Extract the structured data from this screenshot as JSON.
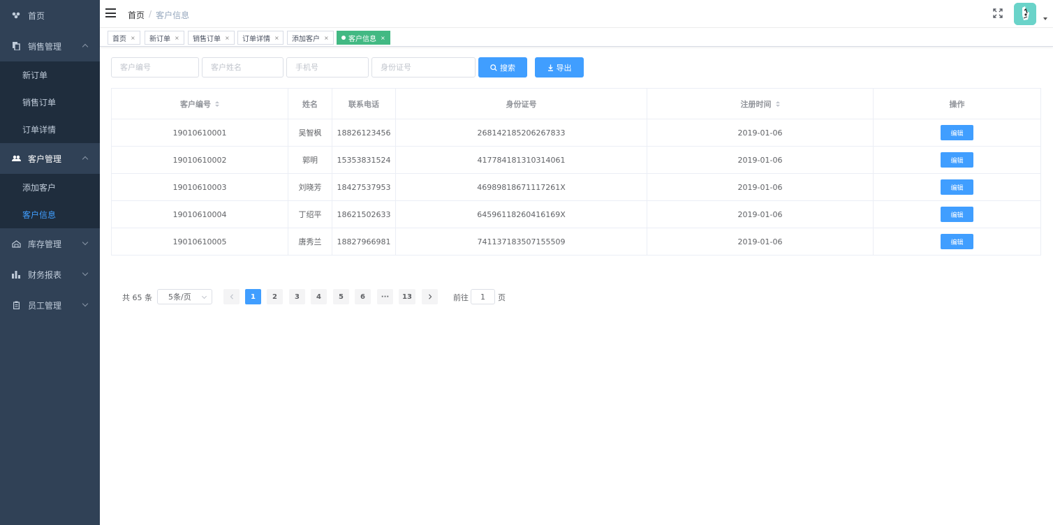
{
  "sidebar": {
    "home": {
      "label": "首页",
      "icon": "dashboard-icon"
    },
    "sales": {
      "label": "销售管理",
      "icon": "documents-icon",
      "items": [
        {
          "label": "新订单"
        },
        {
          "label": "销售订单"
        },
        {
          "label": "订单详情"
        }
      ]
    },
    "customers": {
      "label": "客户管理",
      "icon": "people-icon",
      "items": [
        {
          "label": "添加客户"
        },
        {
          "label": "客户信息"
        }
      ]
    },
    "inventory": {
      "label": "库存管理",
      "icon": "warehouse-icon"
    },
    "finance": {
      "label": "财务报表",
      "icon": "bar-chart-icon"
    },
    "staff": {
      "label": "员工管理",
      "icon": "clipboard-icon"
    }
  },
  "header": {
    "breadcrumb": [
      "首页",
      "客户信息"
    ],
    "breadcrumb_sep": "/"
  },
  "tags": [
    {
      "label": "首页"
    },
    {
      "label": "新订单"
    },
    {
      "label": "销售订单"
    },
    {
      "label": "订单详情"
    },
    {
      "label": "添加客户"
    },
    {
      "label": "客户信息",
      "active": true
    }
  ],
  "filters": {
    "customer_id_placeholder": "客户编号",
    "customer_name_placeholder": "客户姓名",
    "phone_placeholder": "手机号",
    "id_card_placeholder": "身份证号",
    "search_label": "搜索",
    "export_label": "导出"
  },
  "table": {
    "columns": [
      "客户编号",
      "姓名",
      "联系电话",
      "身份证号",
      "注册时间",
      "操作"
    ],
    "rows": [
      {
        "id": "19010610001",
        "name": "吴智枫",
        "phone": "18826123456",
        "id_card": "268142185206267833",
        "date": "2019-01-06"
      },
      {
        "id": "19010610002",
        "name": "郭明",
        "phone": "15353831524",
        "id_card": "417784181310314061",
        "date": "2019-01-06"
      },
      {
        "id": "19010610003",
        "name": "刘晓芳",
        "phone": "18427537953",
        "id_card": "46989818671117261X",
        "date": "2019-01-06"
      },
      {
        "id": "19010610004",
        "name": "丁绍平",
        "phone": "18621502633",
        "id_card": "64596118260416169X",
        "date": "2019-01-06"
      },
      {
        "id": "19010610005",
        "name": "唐秀兰",
        "phone": "18827966981",
        "id_card": "741137183507155509",
        "date": "2019-01-06"
      }
    ],
    "edit_label": "编辑"
  },
  "pagination": {
    "total_text": "共 65 条",
    "page_size": "5条/页",
    "pages": [
      "1",
      "2",
      "3",
      "4",
      "5",
      "6",
      "···",
      "13"
    ],
    "current_page": "1",
    "goto_prefix": "前往",
    "goto_value": "1",
    "goto_suffix": "页"
  },
  "colors": {
    "sidebar_bg": "#304156",
    "submenu_bg": "#1f2d3d",
    "primary": "#409eff",
    "active_tag": "#42b983"
  }
}
